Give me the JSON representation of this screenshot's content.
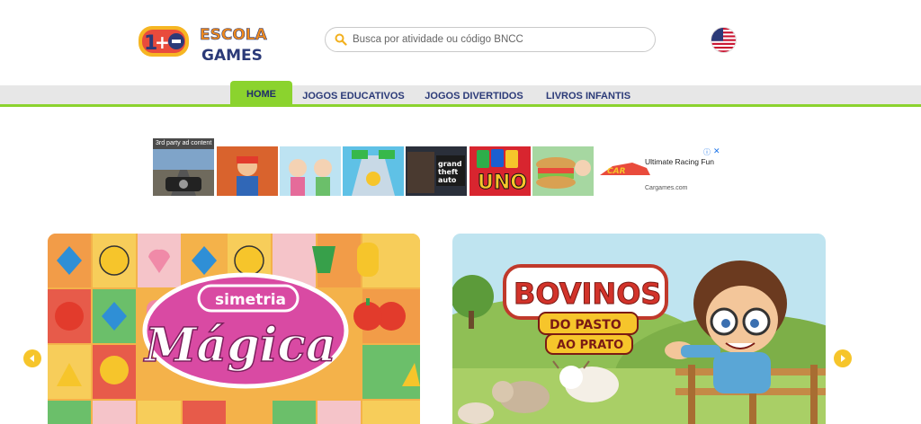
{
  "header": {
    "logo_text_1": "ESCOLA",
    "logo_text_2": "GAMES",
    "search_placeholder": "Busca por atividade ou código BNCC",
    "language_flag": "us-flag-icon"
  },
  "nav": {
    "items": [
      {
        "label": "HOME",
        "active": true
      },
      {
        "label": "JOGOS EDUCATIVOS",
        "active": false
      },
      {
        "label": "JOGOS DIVERTIDOS",
        "active": false
      },
      {
        "label": "LIVROS INFANTIS",
        "active": false
      }
    ]
  },
  "ad": {
    "label": "3rd party ad content",
    "thumbnails": [
      "moto-racing-game",
      "subway-surfers-game",
      "toca-world-game",
      "count-masters-game",
      "grand-theft-auto-game",
      "uno-game",
      "sandwich-game"
    ],
    "uno_text": "UNO",
    "gta_text": "grand theft auto",
    "text_title": "Ultimate Racing Fun",
    "text_domain": "Cargames.com"
  },
  "carousel": {
    "cards": [
      {
        "title_small": "simetria",
        "title_big": "Mágica"
      },
      {
        "title_line1": "BOVINOS",
        "title_line2": "DO PASTO",
        "title_line3": "AO PRATO"
      }
    ]
  },
  "colors": {
    "accent_green": "#8bd32e",
    "nav_text": "#2b3a78",
    "arrow_yellow": "#f6c52b",
    "card_pink": "#d94aa3"
  }
}
